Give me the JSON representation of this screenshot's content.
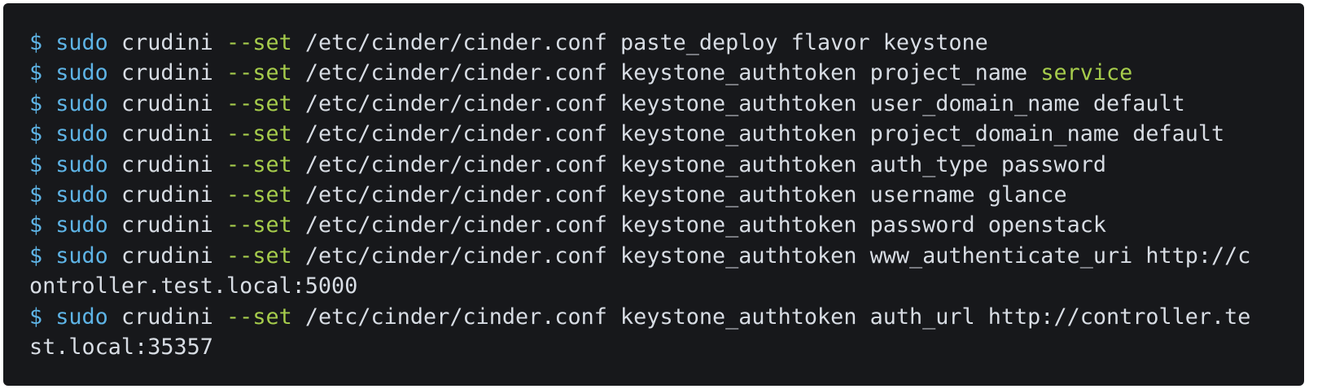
{
  "terminal": {
    "colors": {
      "background": "#17181b",
      "text": "#d8dde4",
      "prompt": "#5eb4e6",
      "keyword": "#5eb4e6",
      "flag": "#a6cc4c",
      "highlight": "#a6cc4c"
    },
    "lines": [
      {
        "prompt": "$",
        "cmd": "sudo",
        "tool": "crudini",
        "flag": "--set",
        "args": "/etc/cinder/cinder.conf paste_deploy flavor keystone",
        "value": ""
      },
      {
        "prompt": "$",
        "cmd": "sudo",
        "tool": "crudini",
        "flag": "--set",
        "args": "/etc/cinder/cinder.conf keystone_authtoken project_name",
        "value": "service"
      },
      {
        "prompt": "$",
        "cmd": "sudo",
        "tool": "crudini",
        "flag": "--set",
        "args": "/etc/cinder/cinder.conf keystone_authtoken user_domain_name default",
        "value": ""
      },
      {
        "prompt": "$",
        "cmd": "sudo",
        "tool": "crudini",
        "flag": "--set",
        "args": "/etc/cinder/cinder.conf keystone_authtoken project_domain_name default",
        "value": ""
      },
      {
        "prompt": "$",
        "cmd": "sudo",
        "tool": "crudini",
        "flag": "--set",
        "args": "/etc/cinder/cinder.conf keystone_authtoken auth_type password",
        "value": ""
      },
      {
        "prompt": "$",
        "cmd": "sudo",
        "tool": "crudini",
        "flag": "--set",
        "args": "/etc/cinder/cinder.conf keystone_authtoken username glance",
        "value": ""
      },
      {
        "prompt": "$",
        "cmd": "sudo",
        "tool": "crudini",
        "flag": "--set",
        "args": "/etc/cinder/cinder.conf keystone_authtoken password openstack",
        "value": ""
      },
      {
        "prompt": "$",
        "cmd": "sudo",
        "tool": "crudini",
        "flag": "--set",
        "args": "/etc/cinder/cinder.conf keystone_authtoken www_authenticate_uri http://c",
        "value": ""
      },
      {
        "prompt": "",
        "cmd": "",
        "tool": "",
        "flag": "",
        "args": "ontroller.test.local:5000",
        "value": ""
      },
      {
        "prompt": "$",
        "cmd": "sudo",
        "tool": "crudini",
        "flag": "--set",
        "args": "/etc/cinder/cinder.conf keystone_authtoken auth_url http://controller.te",
        "value": ""
      },
      {
        "prompt": "",
        "cmd": "",
        "tool": "",
        "flag": "",
        "args": "st.local:35357",
        "value": ""
      }
    ]
  }
}
